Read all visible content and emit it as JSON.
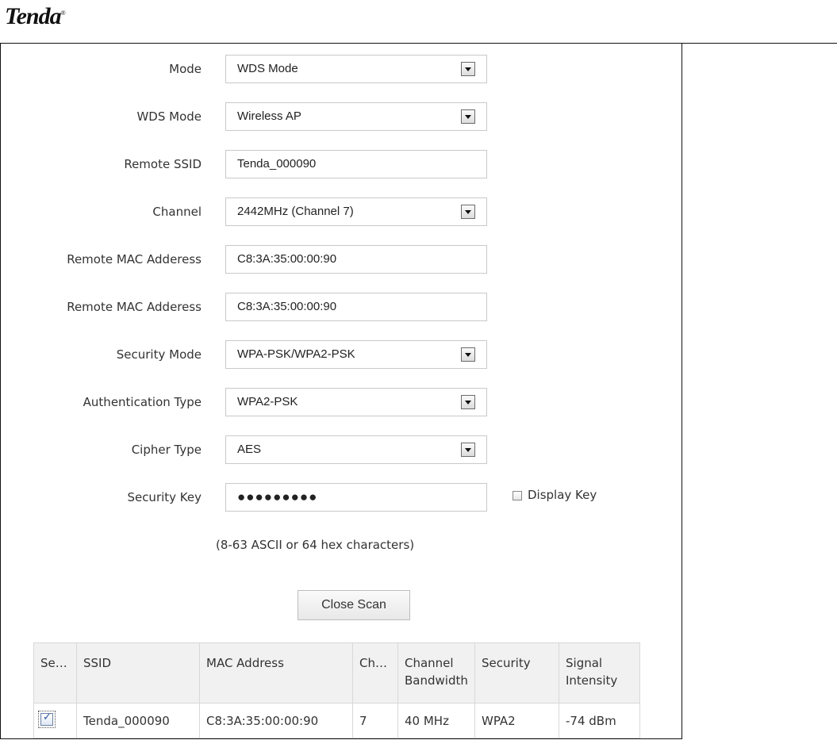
{
  "brand": {
    "logo_text": "Tenda"
  },
  "form": {
    "mode": {
      "label": "Mode",
      "value": "WDS Mode"
    },
    "wds_mode": {
      "label": "WDS Mode",
      "value": "Wireless AP"
    },
    "remote_ssid": {
      "label": "Remote SSID",
      "value": "Tenda_000090"
    },
    "channel": {
      "label": "Channel",
      "value": "2442MHz (Channel 7)"
    },
    "remote_mac_1": {
      "label": "Remote MAC Adderess",
      "value": "C8:3A:35:00:00:90"
    },
    "remote_mac_2": {
      "label": "Remote MAC Adderess",
      "value": "C8:3A:35:00:00:90"
    },
    "security_mode": {
      "label": "Security Mode",
      "value": "WPA-PSK/WPA2-PSK"
    },
    "auth_type": {
      "label": "Authentication Type",
      "value": "WPA2-PSK"
    },
    "cipher_type": {
      "label": "Cipher Type",
      "value": "AES"
    },
    "security_key": {
      "label": "Security Key",
      "value": "●●●●●●●●●"
    },
    "display_key": {
      "label": "Display Key",
      "checked": false
    },
    "key_hint": "(8-63 ASCII or 64 hex characters)",
    "close_scan_label": "Close Scan"
  },
  "scan_table": {
    "headers": [
      "Se…",
      "SSID",
      "MAC Address",
      "Ch…",
      "Channel Bandwidth",
      "Security",
      "Signal Intensity"
    ],
    "rows": [
      {
        "selected": true,
        "ssid": "Tenda_000090",
        "mac": "C8:3A:35:00:00:90",
        "channel": "7",
        "bandwidth": "40 MHz",
        "security": "WPA2",
        "signal": "-74 dBm"
      }
    ]
  }
}
